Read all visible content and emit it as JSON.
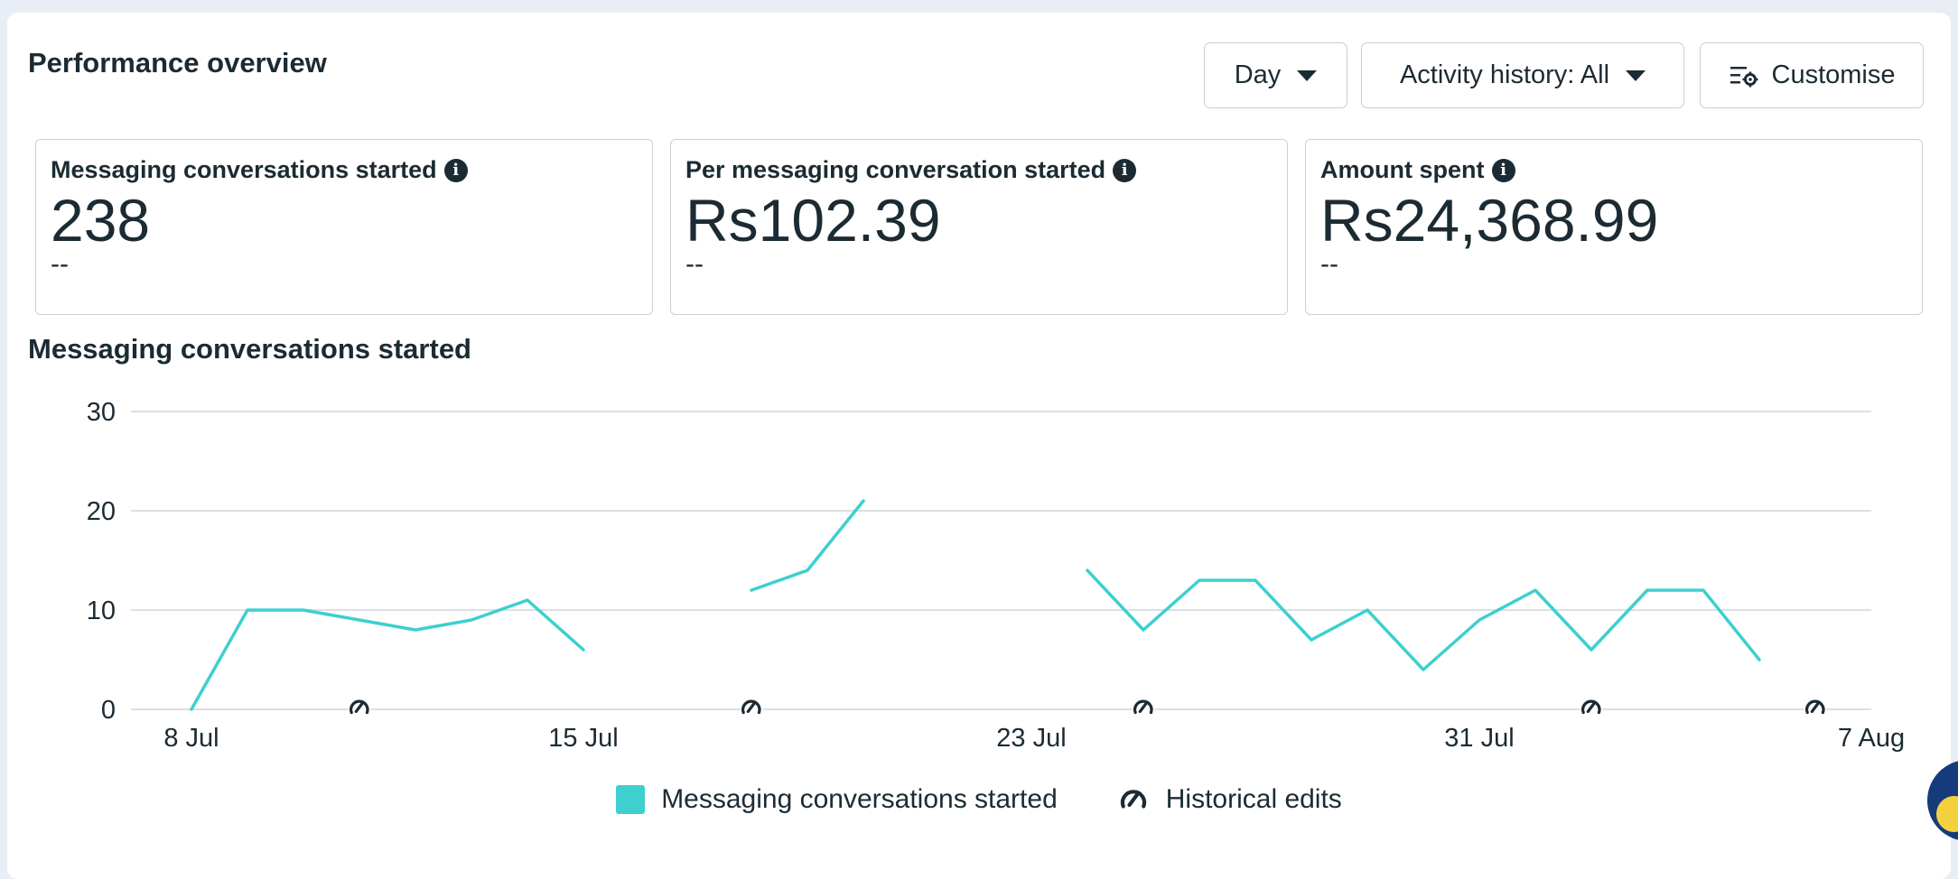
{
  "header": {
    "title": "Performance overview",
    "day_label": "Day",
    "activity_label": "Activity history: All",
    "customise_label": "Customise"
  },
  "metrics": [
    {
      "label": "Messaging conversations started",
      "value": "238",
      "compare": "--"
    },
    {
      "label": "Per messaging conversation started",
      "value": "Rs102.39",
      "compare": "--"
    },
    {
      "label": "Amount spent",
      "value": "Rs24,368.99",
      "compare": "--"
    }
  ],
  "colors": {
    "series": "#3ecfcf",
    "grid": "#dcdfe3",
    "text": "#1c2b33"
  },
  "chart_data": {
    "type": "line",
    "title": "Messaging conversations started",
    "xlabel": "",
    "ylabel": "",
    "ylim": [
      0,
      30
    ],
    "yticks": [
      0,
      10,
      20,
      30
    ],
    "grid": true,
    "legend_position": "bottom",
    "x_start": "8 Jul",
    "x_end": "7 Aug",
    "xtick_labels": [
      {
        "label": "8 Jul",
        "day_index": 0
      },
      {
        "label": "15 Jul",
        "day_index": 7
      },
      {
        "label": "23 Jul",
        "day_index": 15
      },
      {
        "label": "31 Jul",
        "day_index": 23
      },
      {
        "label": "7 Aug",
        "day_index": 30
      }
    ],
    "series": [
      {
        "name": "Messaging conversations started",
        "values": [
          0,
          10,
          10,
          9,
          8,
          9,
          11,
          6,
          null,
          null,
          12,
          14,
          21,
          null,
          null,
          null,
          14,
          8,
          13,
          13,
          7,
          10,
          4,
          9,
          12,
          6,
          12,
          12,
          5
        ]
      }
    ],
    "historical_edits": {
      "name": "Historical edits",
      "day_indices": [
        3,
        10,
        17,
        25,
        29
      ]
    }
  },
  "legend": {
    "series_label": "Messaging conversations started",
    "edits_label": "Historical edits"
  }
}
